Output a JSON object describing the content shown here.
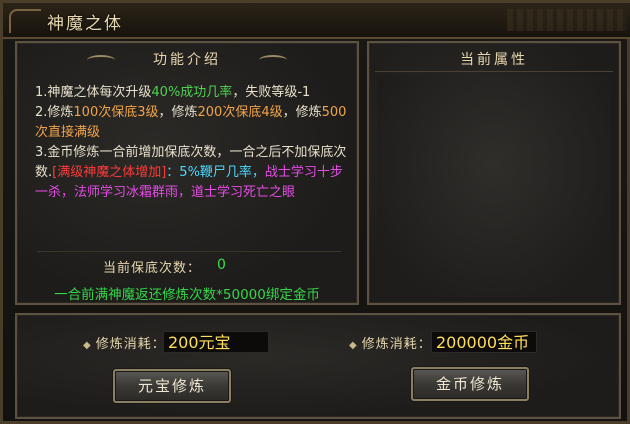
{
  "window": {
    "title": "神魔之体"
  },
  "left_panel": {
    "header": "功能介绍",
    "rules": {
      "r1_prefix": "1.神魔之体每次升级",
      "r1_green": "40%成功几率",
      "r1_suffix": "，失败等级-1",
      "r2_prefix": "2.修炼",
      "r2_orange1": "100次保底3级",
      "r2_mid": "，修炼",
      "r2_orange2": "200次保底4级",
      "r2_mid2": "，修炼",
      "r2_orange3": "500次直接满级",
      "r3_text": "3.金币修炼一合前增加保底次数，一合之后不加保底次数.",
      "r3_red": "[满级神魔之体增加]",
      "r3_cyan": "：5%鞭尸几率，",
      "r3_pink": "战士学习十步一杀，法师学习冰霜群雨，道士学习死亡之眼"
    },
    "guarantee_label": "当前保底次数：",
    "guarantee_value": "0",
    "return_note": "一合前满神魔返还修炼次数*50000绑定金币"
  },
  "right_panel": {
    "header": "当前属性"
  },
  "bottom": {
    "yuanbao": {
      "label": "修炼消耗：",
      "value": "200元宝",
      "button": "元宝修炼"
    },
    "gold": {
      "label": "修炼消耗：",
      "value": "200000金币",
      "button": "金币修炼"
    }
  }
}
